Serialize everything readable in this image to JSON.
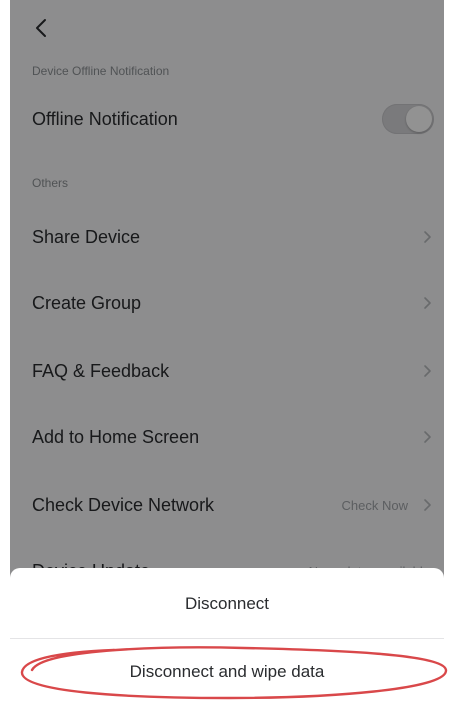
{
  "header": {
    "back_icon": "chevron-left-icon"
  },
  "sections": {
    "offline_title": "Device Offline Notification",
    "others_title": "Others"
  },
  "rows": [
    {
      "label": "Offline Notification",
      "toggle_on": false
    },
    {
      "label": "Share Device"
    },
    {
      "label": "Create Group"
    },
    {
      "label": "FAQ & Feedback"
    },
    {
      "label": "Add to Home Screen"
    },
    {
      "label": "Check Device Network",
      "value": "Check Now"
    },
    {
      "label": "Device Update",
      "value": "No updates available"
    }
  ],
  "sheet": {
    "disconnect": "Disconnect",
    "disconnect_wipe": "Disconnect and wipe data"
  },
  "colors": {
    "highlight": "#d9484a",
    "overlay": "#000000"
  }
}
